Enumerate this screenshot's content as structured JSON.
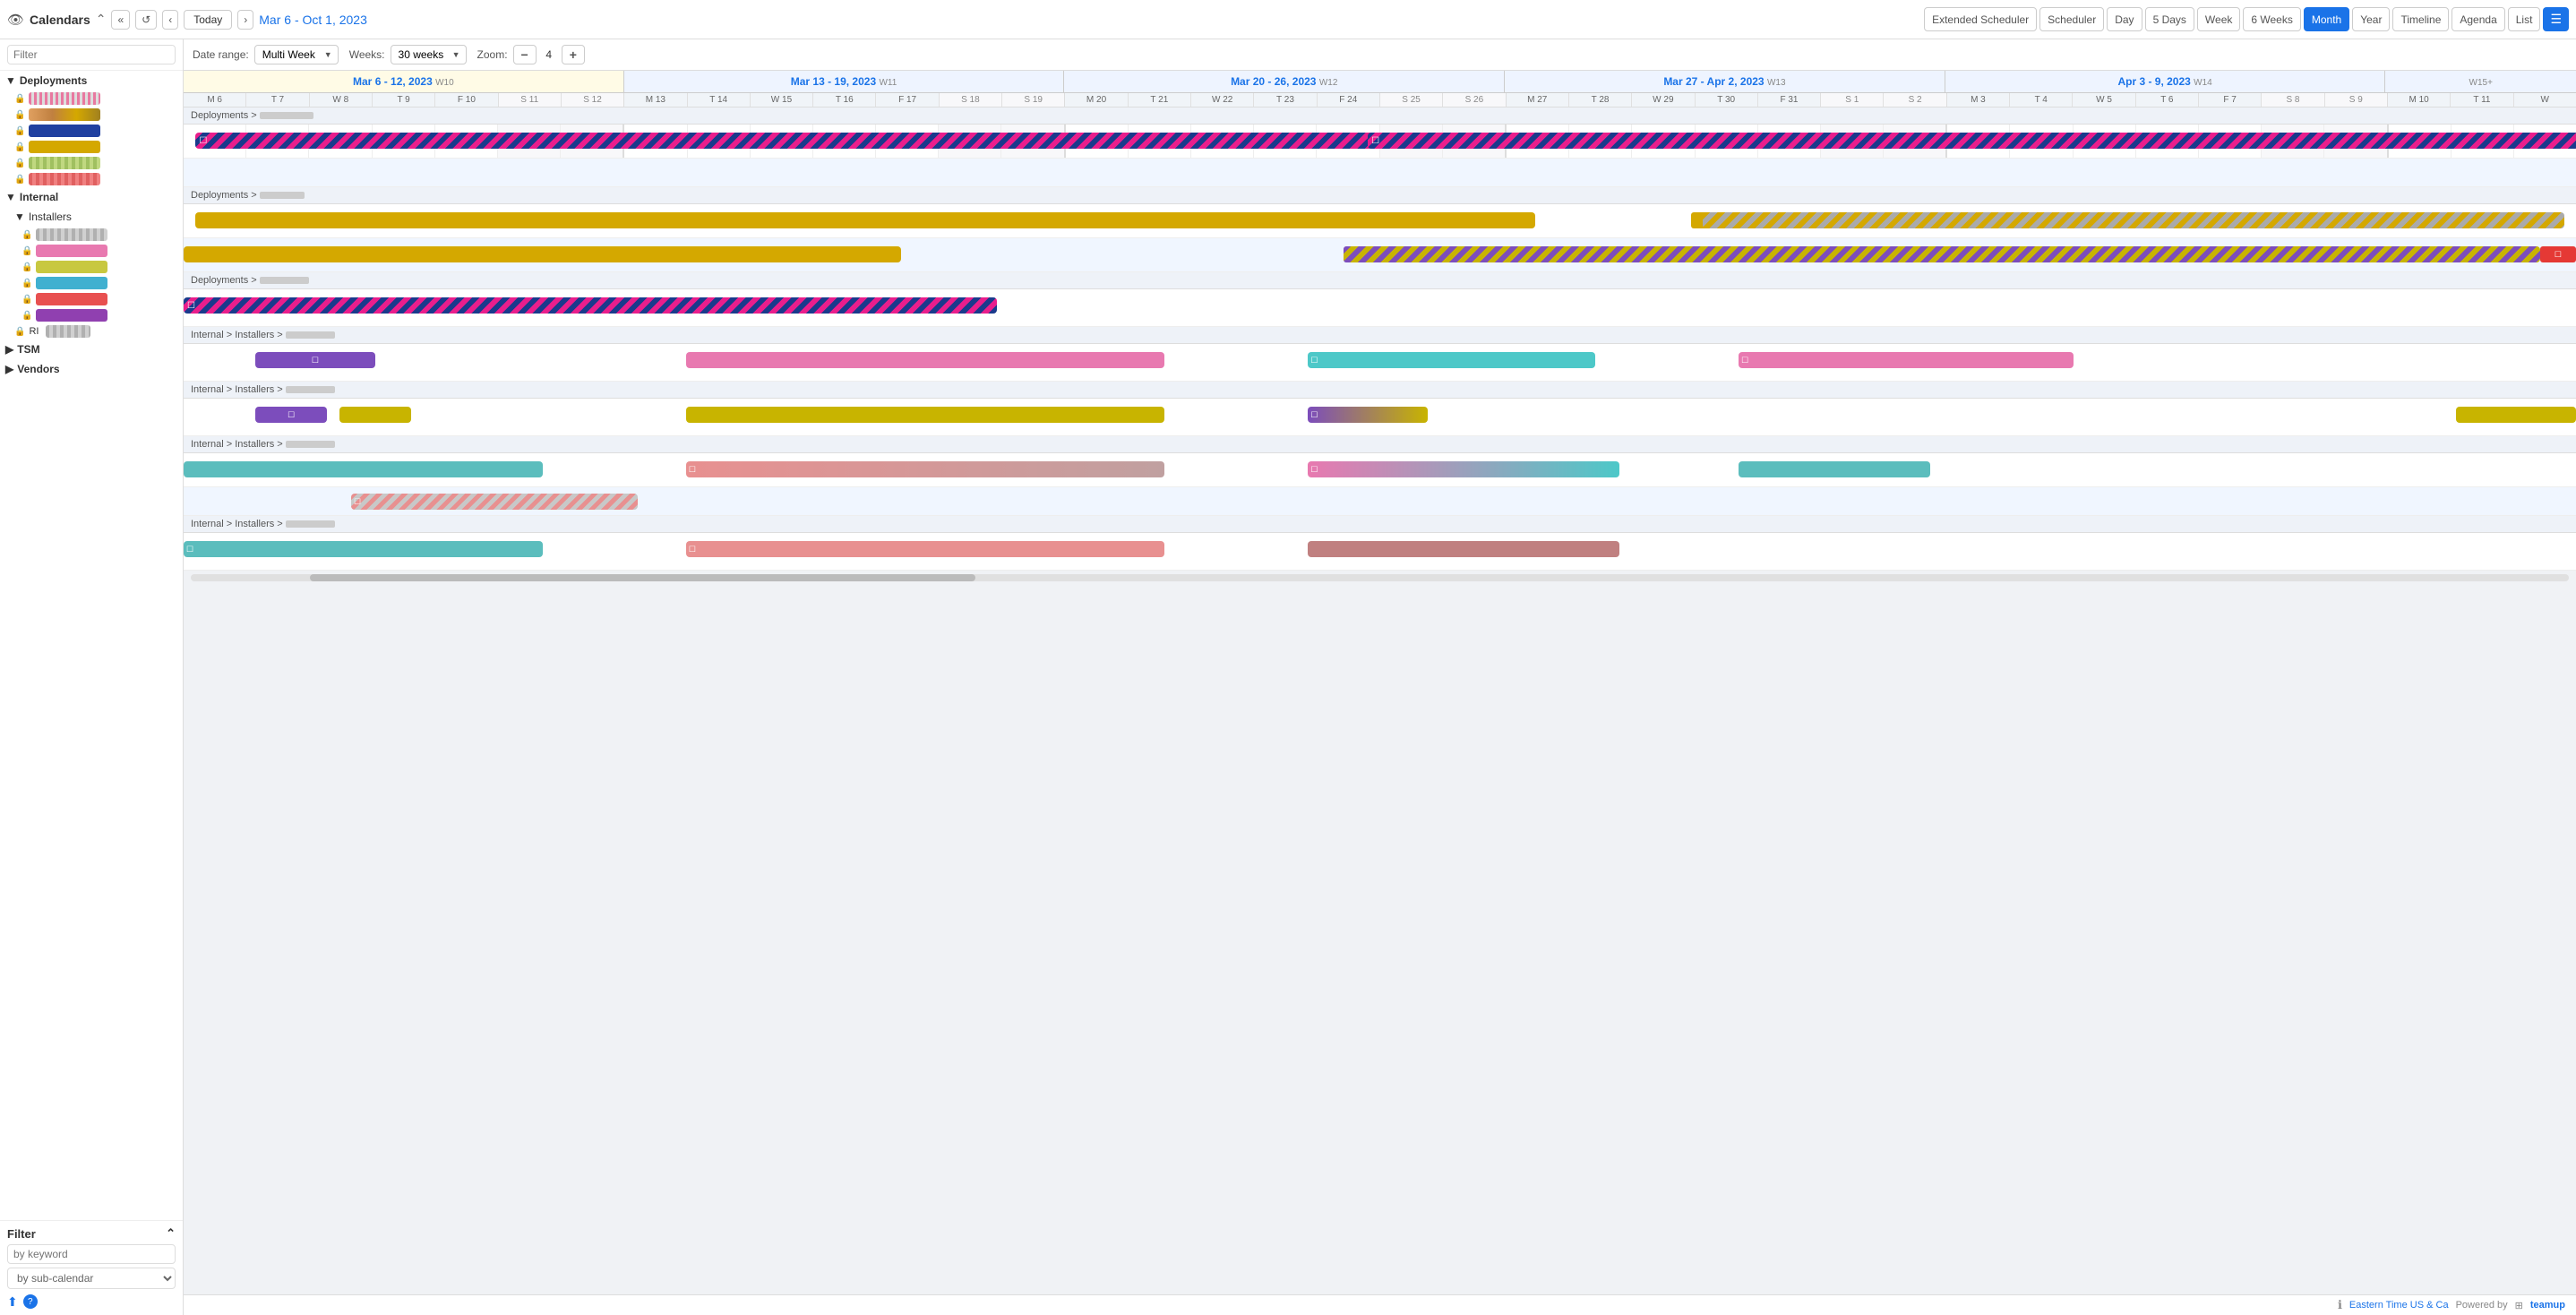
{
  "header": {
    "title": "Calendars",
    "dateRange": "Mar 6 - Oct 1, 2023",
    "todayLabel": "Today",
    "viewButtons": [
      {
        "id": "extended",
        "label": "Extended Scheduler",
        "active": false
      },
      {
        "id": "scheduler",
        "label": "Scheduler",
        "active": false
      },
      {
        "id": "day",
        "label": "Day",
        "active": false
      },
      {
        "id": "5days",
        "label": "5 Days",
        "active": false
      },
      {
        "id": "week",
        "label": "Week",
        "active": false
      },
      {
        "id": "6weeks",
        "label": "6 Weeks",
        "active": false
      },
      {
        "id": "month",
        "label": "Month",
        "active": true
      },
      {
        "id": "year",
        "label": "Year",
        "active": false
      },
      {
        "id": "timeline",
        "label": "Timeline",
        "active": false
      },
      {
        "id": "agenda",
        "label": "Agenda",
        "active": false
      },
      {
        "id": "list",
        "label": "List",
        "active": false
      }
    ]
  },
  "toolbar": {
    "dateRangeLabel": "Date range:",
    "dateRangeValue": "Multi Week",
    "weeksLabel": "Weeks:",
    "weeksValue": "30 weeks",
    "zoomLabel": "Zoom:",
    "zoomValue": "4"
  },
  "sidebar": {
    "filterPlaceholder": "Filter",
    "groups": [
      {
        "name": "Deployments",
        "expanded": true,
        "items": [
          {
            "color": "#e879a0",
            "locked": true,
            "pattern": "solid"
          },
          {
            "color": "#e0a060",
            "locked": true,
            "pattern": "gradient"
          },
          {
            "color": "#2040a0",
            "locked": true,
            "pattern": "solid"
          },
          {
            "color": "#d4a800",
            "locked": true,
            "pattern": "solid"
          },
          {
            "color": "#a0c060",
            "locked": true,
            "pattern": "striped"
          },
          {
            "color": "#e06060",
            "locked": true,
            "pattern": "striped"
          }
        ]
      },
      {
        "name": "Internal",
        "expanded": true,
        "subGroups": [
          {
            "name": "Installers",
            "expanded": true,
            "items": [
              {
                "color": "#b0b0b0",
                "locked": true,
                "pattern": "striped"
              },
              {
                "color": "#e879b0",
                "locked": true,
                "pattern": "solid"
              },
              {
                "color": "#c8c840",
                "locked": true,
                "pattern": "solid"
              },
              {
                "color": "#40b0d0",
                "locked": true,
                "pattern": "solid"
              },
              {
                "color": "#e85050",
                "locked": true,
                "pattern": "solid"
              },
              {
                "color": "#9040b0",
                "locked": true,
                "pattern": "solid"
              }
            ]
          },
          {
            "name": "RI",
            "items": [
              {
                "color": "#b0b0b0",
                "locked": true,
                "pattern": "striped"
              }
            ]
          }
        ]
      },
      {
        "name": "TSM",
        "expanded": false,
        "items": []
      },
      {
        "name": "Vendors",
        "expanded": false,
        "items": []
      }
    ],
    "bottomFilter": {
      "title": "Filter",
      "keywordPlaceholder": "by keyword",
      "subCalendarPlaceholder": "by sub-calendar"
    }
  },
  "calendar": {
    "weeks": [
      {
        "label": "Mar 6 - 12, 2023",
        "num": "W10",
        "days": [
          "M 6",
          "T 7",
          "W 8",
          "T 9",
          "F 10",
          "S 11",
          "S 12"
        ]
      },
      {
        "label": "Mar 13 - 19, 2023",
        "num": "W11",
        "days": [
          "M 13",
          "T 14",
          "W 15",
          "T 16",
          "F 17",
          "S 18",
          "S 19"
        ]
      },
      {
        "label": "Mar 20 - 26, 2023",
        "num": "W12",
        "days": [
          "M 20",
          "T 21",
          "W 22",
          "T 23",
          "F 24",
          "S 25",
          "S 26"
        ]
      },
      {
        "label": "Mar 27 - Apr 2, 2023",
        "num": "W13",
        "days": [
          "M 27",
          "T 28",
          "W 29",
          "T 30",
          "F 31",
          "S 1",
          "S 2"
        ]
      },
      {
        "label": "Apr 3 - 9, 2023",
        "num": "W14",
        "days": [
          "M 3",
          "T 4",
          "W 5",
          "T 6",
          "F 7",
          "S 8",
          "S 9"
        ]
      },
      {
        "label": "...",
        "num": "W15+",
        "days": [
          "M 10",
          "T 11",
          "W"
        ]
      }
    ],
    "sections": [
      {
        "label": "Deployments >",
        "rows": [
          {
            "events": [
              {
                "style": "stripe-pink-blue",
                "left": "0%",
                "width": "58%",
                "icon": "☐"
              },
              {
                "style": "stripe-blue-pink",
                "left": "49%",
                "width": "51%",
                "icon": "☐"
              }
            ]
          },
          {
            "events": []
          }
        ]
      },
      {
        "label": "Deployments >",
        "rows": [
          {
            "events": [
              {
                "style": "ev-gold",
                "left": "0%",
                "width": "58%"
              },
              {
                "style": "stripe-gold-gray",
                "left": "63%",
                "width": "37%"
              },
              {
                "icon": "☐",
                "style": "ev-gold",
                "left": "63%",
                "width": "2%"
              }
            ]
          },
          {
            "events": [
              {
                "style": "ev-gold",
                "left": "0%",
                "width": "31%"
              },
              {
                "style": "stripe-purple-gold",
                "left": "48%",
                "width": "52%"
              },
              {
                "icon": "☐",
                "style": "ev-red",
                "left": "98.5%",
                "width": "1.5%"
              }
            ]
          }
        ]
      },
      {
        "label": "Deployments >",
        "rows": [
          {
            "events": [
              {
                "style": "stripe-blue-pink",
                "left": "0%",
                "width": "33%",
                "icon": "☐"
              }
            ]
          }
        ]
      },
      {
        "label": "Internal > Installers >",
        "rows": [
          {
            "events": [
              {
                "style": "ev-purple",
                "left": "3%",
                "width": "5%",
                "icon": "☐"
              },
              {
                "style": "ev-pink",
                "left": "22%",
                "width": "20%"
              },
              {
                "style": "ev-teal",
                "left": "47%",
                "width": "13%",
                "icon": "☐"
              },
              {
                "style": "ev-pink2",
                "left": "65%",
                "width": "14%",
                "icon": "☐"
              }
            ]
          }
        ]
      },
      {
        "label": "Internal > Installers >",
        "rows": [
          {
            "events": [
              {
                "style": "ev-purple",
                "left": "3%",
                "width": "3%",
                "icon": "☐"
              },
              {
                "style": "ev-yellow",
                "left": "6%",
                "width": "3%"
              },
              {
                "style": "ev-yellow",
                "left": "22%",
                "width": "20%"
              },
              {
                "style": "ev-purple",
                "left": "47%",
                "width": "5%",
                "icon": "☐"
              },
              {
                "style": "ev-gold",
                "left": "96%",
                "width": "4%"
              }
            ]
          }
        ]
      },
      {
        "label": "Internal > Installers >",
        "rows": [
          {
            "events": [
              {
                "style": "ev-teal2",
                "left": "0%",
                "width": "15%"
              },
              {
                "style": "ev-salmon2",
                "left": "22%",
                "width": "20%",
                "icon": "☐"
              },
              {
                "style": "ev-pink-teal",
                "left": "47%",
                "width": "13%",
                "icon": "☐"
              },
              {
                "style": "ev-teal2",
                "left": "65%",
                "width": "8%"
              }
            ]
          },
          {
            "events": [
              {
                "style": "stripe-salmon",
                "left": "7%",
                "width": "12%",
                "icon": "☐"
              }
            ]
          }
        ]
      },
      {
        "label": "Internal > Installers >",
        "rows": [
          {
            "events": [
              {
                "style": "ev-teal2",
                "left": "0%",
                "width": "15%",
                "icon": "☐"
              },
              {
                "style": "ev-salmon",
                "left": "22%",
                "width": "20%",
                "icon": "☐"
              },
              {
                "style": "ev-salmon2",
                "left": "47%",
                "width": "13%"
              }
            ]
          }
        ]
      }
    ]
  },
  "footer": {
    "timezone": "Eastern Time US & Ca",
    "poweredBy": "Powered by",
    "brand": "teamup"
  }
}
